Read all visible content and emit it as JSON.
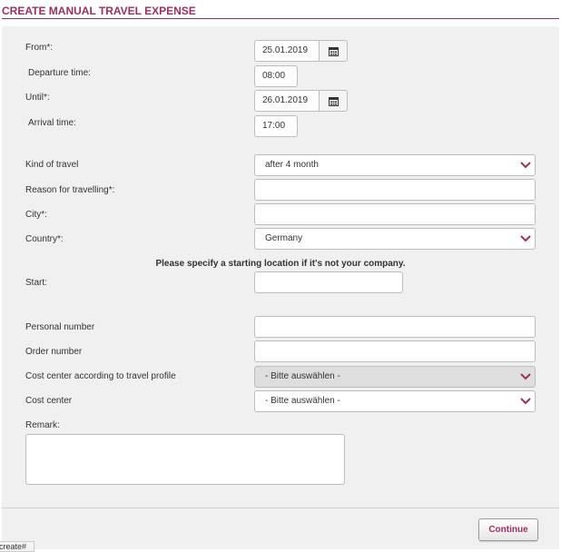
{
  "header": {
    "title": "CREATE MANUAL TRAVEL EXPENSE"
  },
  "form": {
    "from": {
      "label": "From*:",
      "value": "25.01.2019"
    },
    "departure": {
      "label": "Departure time:",
      "value": "08:00"
    },
    "until": {
      "label": "Until*:",
      "value": "26.01.2019"
    },
    "arrival": {
      "label": "Arrival time:",
      "value": "17:00"
    },
    "kind_of_travel": {
      "label": "Kind of travel",
      "value": "after 4 month"
    },
    "reason": {
      "label": "Reason for travelling*:",
      "value": ""
    },
    "city": {
      "label": "City*:",
      "value": ""
    },
    "country": {
      "label": "Country*:",
      "value": "Germany"
    },
    "start_notice": "Please specify a starting location if it's not your company.",
    "start": {
      "label": "Start:",
      "value": ""
    },
    "personal_number": {
      "label": "Personal number",
      "value": ""
    },
    "order_number": {
      "label": "Order number",
      "value": ""
    },
    "cost_center_profile": {
      "label": "Cost center according to travel profile",
      "value": "- Bitte auswählen -"
    },
    "cost_center": {
      "label": "Cost center",
      "value": "- Bitte auswählen -"
    },
    "remark": {
      "label": "Remark:",
      "value": ""
    }
  },
  "footer": {
    "continue_label": "Continue"
  },
  "status_bar": {
    "text": "create#"
  },
  "icons": {
    "calendar": "calendar-icon",
    "dropdown": "chevron-down-icon"
  },
  "colors": {
    "accent": "#9c2f5e",
    "panel": "#f0f0f0",
    "border": "#bdbdbd"
  }
}
